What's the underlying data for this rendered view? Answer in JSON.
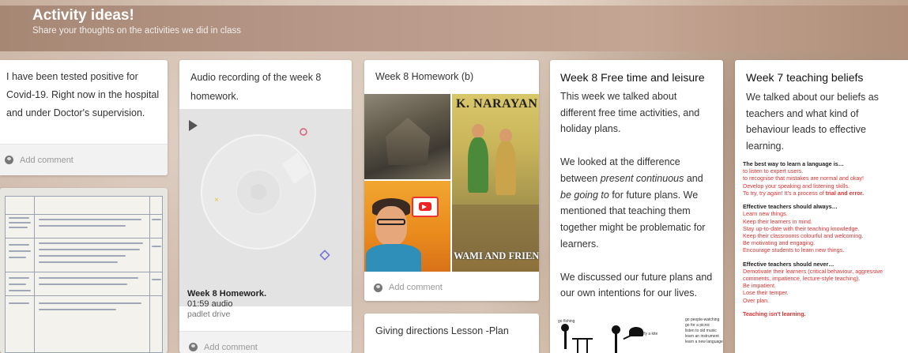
{
  "header": {
    "title": "Activity ideas!",
    "subtitle": "Share your thoughts on the activities we did in class"
  },
  "cards": {
    "c1": {
      "text": "I have been tested positive for Covid-19. Right now in the hospital and under Doctor's supervision.",
      "comment": "Add comment"
    },
    "c2": {
      "title": "Audio recording of the week 8 homework.",
      "audio_title": "Week 8 Homework.",
      "audio_duration": "01:59 audio",
      "audio_source": "padlet drive",
      "comment": "Add comment"
    },
    "c3": {
      "title": "Week 8 Homework (b)",
      "img_text_1": "K. NARAYAN",
      "img_text_2": "WAMI AND FRIEND",
      "comment": "Add comment"
    },
    "c3b": {
      "title": "Giving directions Lesson -Plan"
    },
    "c4": {
      "title": "Week 8 Free time and leisure",
      "p1": "This week we talked about different free time activities, and holiday plans.",
      "p2_a": "We looked at the difference between ",
      "p2_em1": "present continuous",
      "p2_b": " and ",
      "p2_em2": "be going to",
      "p2_c": " for future plans. We mentioned that teaching them together might be problematic for learners.",
      "p3": "We discussed our future plans and our own intentions for our lives.",
      "img_labels": [
        "go fishing",
        "fly a kite",
        "go people-watching",
        "go for a picnic",
        "listen to old music",
        "learn an instrument",
        "learn a new language"
      ]
    },
    "c5": {
      "title": "Week 7 teaching beliefs",
      "intro": "We talked about our beliefs as teachers and what kind of behaviour leads to effective learning.",
      "h1": "The best way to learn a language is…",
      "l1": [
        "to listen to expert users.",
        "to recognise that mistakes are normal and okay!",
        "Develop your speaking and listening skills."
      ],
      "l1_last_a": "To try, try again! It's a process of ",
      "l1_last_b": "trial and error.",
      "h2": "Effective teachers should always…",
      "l2": [
        "Learn new things.",
        "Keep their learners in mind.",
        "Stay up-to-date with their teaching knowledge.",
        "Keep their classrooms colourful and welcoming.",
        "Be motivating and engaging.",
        "Encourage students to learn new things."
      ],
      "h3": "Effective teachers should never…",
      "l3": [
        "Demotivate their learners (critical behaviour, aggressive comments, impatience, lecture-style teaching).",
        "Be impatient.",
        "Lose their temper.",
        "Over plan."
      ],
      "footer": "Teaching isn't learning."
    }
  },
  "icons": {
    "avatar": "avatar-icon",
    "play": "play-icon"
  },
  "colors": {
    "accent_red": "#dd3333",
    "header_brown": "#a68774"
  }
}
